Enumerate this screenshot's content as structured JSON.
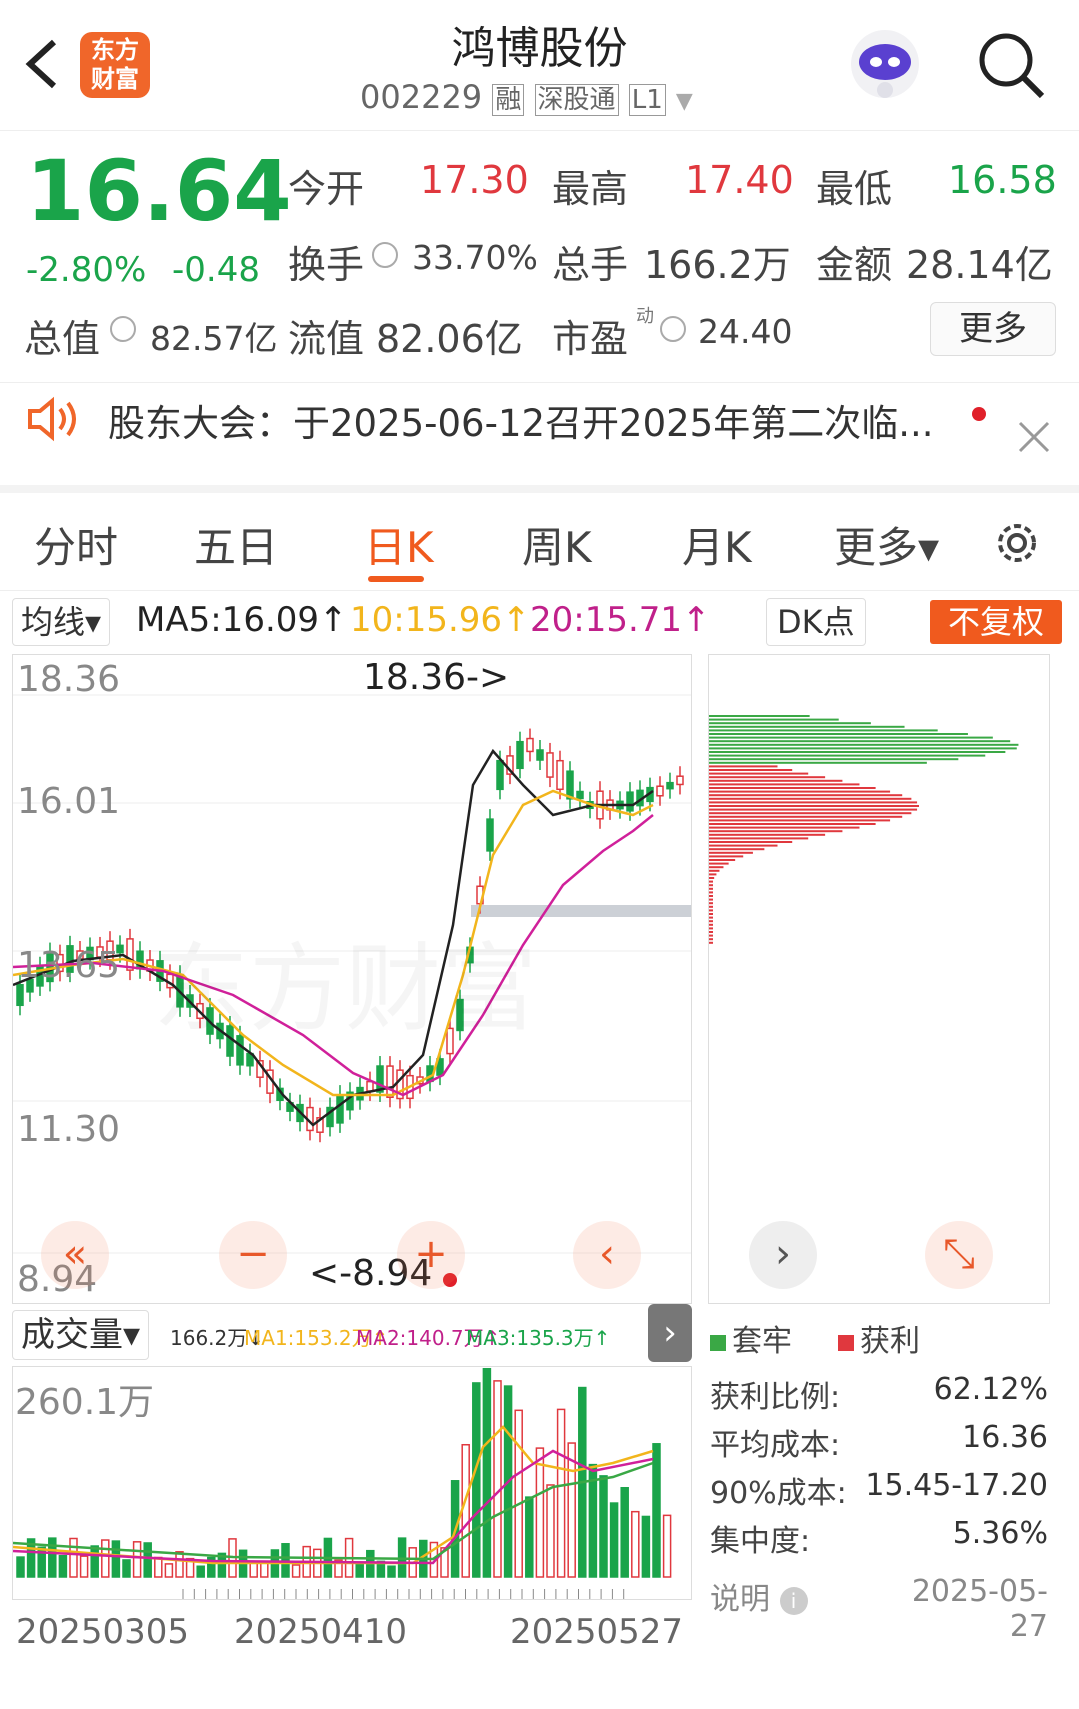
{
  "header": {
    "stock_name": "鸿博股份",
    "code": "002229",
    "tags": [
      "融",
      "深股通",
      "L1"
    ],
    "logo_text": "东方\n财富"
  },
  "quote": {
    "price": "16.64",
    "change_pct": "-2.80%",
    "change_abs": "-0.48",
    "open_label": "今开",
    "open": "17.30",
    "high_label": "最高",
    "high": "17.40",
    "low_label": "最低",
    "low": "16.58",
    "turnover_label": "换手",
    "turnover": "33.70%",
    "volume_label": "总手",
    "volume": "166.2万",
    "amount_label": "金额",
    "amount": "28.14亿",
    "mktcap_label": "总值",
    "mktcap": "82.57亿",
    "float_label": "流值",
    "float": "82.06亿",
    "pe_label": "市盈",
    "pe_sup": "动",
    "pe": "24.40",
    "more_label": "更多"
  },
  "notice": {
    "text": "股东大会：于2025-06-12召开2025年第二次临..."
  },
  "tabs": [
    "分时",
    "五日",
    "日K",
    "周K",
    "月K",
    "更多▾"
  ],
  "active_tab": 2,
  "indicator": {
    "selector": "均线▾",
    "ma5": "MA5:16.09↑",
    "ma10": "10:15.96↑",
    "ma20": "20:15.71↑",
    "dk": "DK点",
    "fq": "不复权"
  },
  "kline": {
    "y_labels": [
      "18.36",
      "16.01",
      "13.65",
      "11.30",
      "8.94"
    ],
    "max_note": "18.36->",
    "min_note": "<-8.94",
    "watermark": "东方财富"
  },
  "volume": {
    "selector": "成交量▾",
    "current": "166.2万↓",
    "ma1": "MA1:153.2万↑",
    "ma2": "MA2:140.7万↑",
    "ma3": "MA3:135.3万↑",
    "y_label": "260.1万",
    "dates": [
      "20250305",
      "20250410",
      "20250527"
    ]
  },
  "chips": {
    "legend_trap": "套牢",
    "legend_profit": "获利",
    "stats": [
      {
        "label": "获利比例:",
        "value": "62.12%"
      },
      {
        "label": "平均成本:",
        "value": "16.36"
      },
      {
        "label": "90%成本:",
        "value": "15.45-17.20"
      },
      {
        "label": "集中度:",
        "value": "5.36%"
      }
    ],
    "note_label": "说明",
    "date": "2025-05-27"
  },
  "colors": {
    "up": "#e0383e",
    "down": "#1aa44a",
    "accent": "#f05a1e",
    "ma5": "#222222",
    "ma10": "#f2b51c",
    "ma20": "#d0209a"
  }
}
